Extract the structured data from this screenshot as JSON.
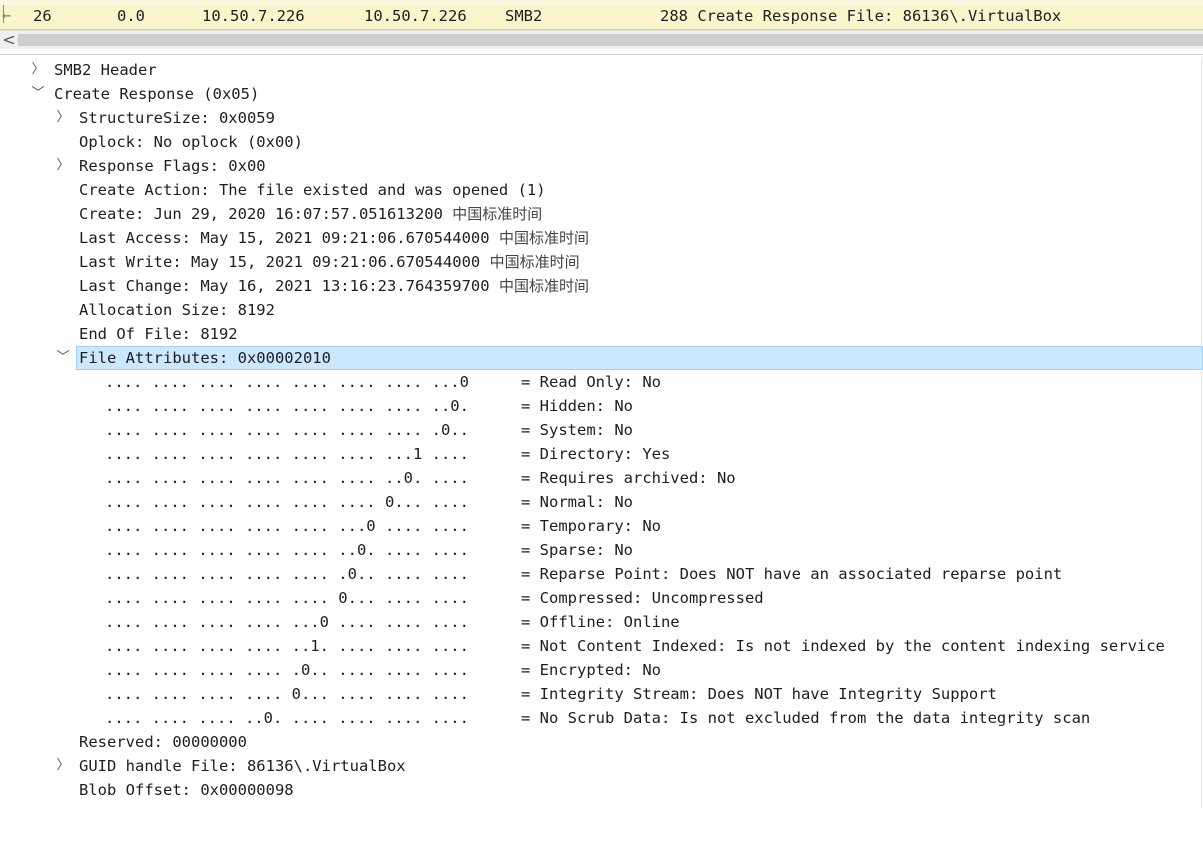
{
  "packet_list": {
    "row": {
      "no": "26",
      "time": "0.0",
      "source": "10.50.7.226",
      "destination": "10.50.7.226",
      "protocol": "SMB2",
      "info": "288 Create Response File: 86136\\.VirtualBox"
    }
  },
  "scrollbar": {
    "left_arrow": "<"
  },
  "detail": {
    "smb2_header": "SMB2 Header",
    "create_response": "Create Response (0x05)",
    "structure_size": "StructureSize: 0x0059",
    "oplock": "Oplock: No oplock (0x00)",
    "response_flags": "Response Flags: 0x00",
    "create_action": "Create Action: The file existed and was opened (1)",
    "create": "Create: Jun 29, 2020 16:07:57.051613200",
    "last_access": "Last Access: May 15, 2021 09:21:06.670544000",
    "last_write": "Last Write: May 15, 2021 09:21:06.670544000",
    "last_change": "Last Change: May 16, 2021 13:16:23.764359700",
    "tz_suffix": "中国标准时间",
    "allocation_size": "Allocation Size: 8192",
    "end_of_file": "End Of File: 8192",
    "file_attributes": "File Attributes: 0x00002010",
    "attributes": [
      {
        "bits": ".... .... .... .... .... .... .... ...0",
        "label": "= Read Only: No"
      },
      {
        "bits": ".... .... .... .... .... .... .... ..0.",
        "label": "= Hidden: No"
      },
      {
        "bits": ".... .... .... .... .... .... .... .0..",
        "label": "= System: No"
      },
      {
        "bits": ".... .... .... .... .... .... ...1 ....",
        "label": "= Directory: Yes"
      },
      {
        "bits": ".... .... .... .... .... .... ..0. ....",
        "label": "= Requires archived: No"
      },
      {
        "bits": ".... .... .... .... .... .... 0... ....",
        "label": "= Normal: No"
      },
      {
        "bits": ".... .... .... .... .... ...0 .... ....",
        "label": "= Temporary: No"
      },
      {
        "bits": ".... .... .... .... .... ..0. .... ....",
        "label": "= Sparse: No"
      },
      {
        "bits": ".... .... .... .... .... .0.. .... ....",
        "label": "= Reparse Point: Does NOT have an associated reparse point"
      },
      {
        "bits": ".... .... .... .... .... 0... .... ....",
        "label": "= Compressed: Uncompressed"
      },
      {
        "bits": ".... .... .... .... ...0 .... .... ....",
        "label": "= Offline: Online"
      },
      {
        "bits": ".... .... .... .... ..1. .... .... ....",
        "label": "= Not Content Indexed: Is not indexed by the content indexing service"
      },
      {
        "bits": ".... .... .... .... .0.. .... .... ....",
        "label": "= Encrypted: No"
      },
      {
        "bits": ".... .... .... .... 0... .... .... ....",
        "label": "= Integrity Stream: Does NOT have Integrity Support"
      },
      {
        "bits": ".... .... .... ..0. .... .... .... ....",
        "label": "= No Scrub Data: Is not excluded from the data integrity scan"
      }
    ],
    "reserved": "Reserved: 00000000",
    "guid_handle": "GUID handle File: 86136\\.VirtualBox",
    "blob_offset": "Blob Offset: 0x00000098"
  },
  "colors": {
    "packet_row_bg": "#fbf5cc",
    "selection_bg": "#cce8ff",
    "selection_border": "#99d1ff"
  },
  "icons": {
    "collapsed": "chevron-right-icon",
    "expanded": "chevron-down-icon",
    "related_packet": "related-packet-arrow-icon"
  }
}
